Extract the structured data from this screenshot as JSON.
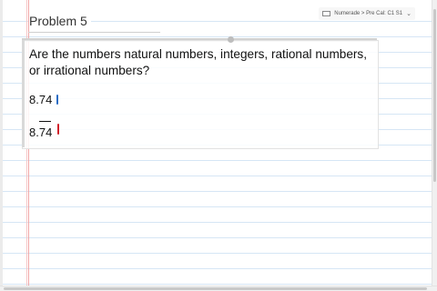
{
  "page": {
    "title": "Problem 5"
  },
  "breadcrumb": {
    "path": "Numerade > Pre Cal: C1 S1",
    "chevron": "⌄"
  },
  "content": {
    "question": "Are the numbers natural numbers, integers, rational numbers, or irrational numbers?",
    "number_1": "8.74",
    "number_2": "8.74"
  },
  "ink": {
    "blue": "#2b6cc4",
    "red": "#d0202a"
  }
}
